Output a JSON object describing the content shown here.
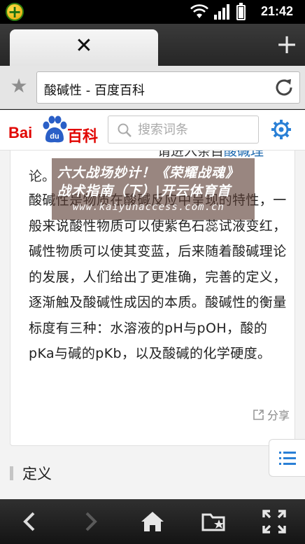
{
  "status_bar": {
    "time": "21:42"
  },
  "tabs": {
    "close_glyph": "✕",
    "new_tab_glyph": "+"
  },
  "address_bar": {
    "url_title": "酸碱性 - 百度百科"
  },
  "baike_header": {
    "logo_bai": "Bai",
    "logo_du": "du",
    "logo_baike": "百科",
    "search_placeholder": "搜索词条"
  },
  "article": {
    "top_partial_prefix": "请进入条目",
    "top_partial_link": "酸碱理",
    "top_partial_line2": "论。",
    "paragraph": "酸碱性是物质在酸碱反应中呈现的特性，一般来说酸性物质可以使紫色石蕊试液变红，碱性物质可以使其变蓝，后来随着酸碱理论的发展，人们给出了更准确，完善的定义，逐渐触及酸碱性成因的本质。酸碱性的衡量标度有三种：水溶液的pH与pOH，酸的pKa与碱的pKb，以及酸碱的化学硬度。",
    "share_label": "分享",
    "section_title": "定义"
  },
  "overlay": {
    "line1": "六大战场妙计！《荣耀战魂》",
    "line2": "战术指南（下）|开云体育首",
    "line3": "www.kaiyunaccess.com.cn"
  },
  "colors": {
    "baidu_red": "#e10602",
    "baidu_blue": "#2a5fc7",
    "accent_blue": "#2a80d6"
  }
}
